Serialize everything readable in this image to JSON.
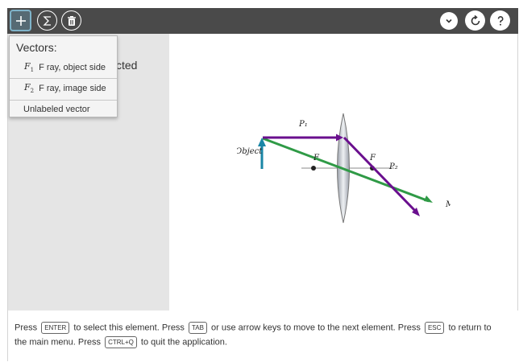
{
  "toolbar": {
    "buttons": [
      {
        "name": "add-button",
        "icon": "plus-icon"
      },
      {
        "name": "sum-button",
        "icon": "sigma-icon"
      },
      {
        "name": "delete-button",
        "icon": "trash-icon"
      },
      {
        "name": "dropdown-button",
        "icon": "chevron-down-icon"
      },
      {
        "name": "refresh-button",
        "icon": "refresh-icon"
      },
      {
        "name": "help-button",
        "icon": "question-icon"
      }
    ],
    "background": "#4a4a4a"
  },
  "sidebar": {
    "behind_text": "cted"
  },
  "menu": {
    "title": "Vectors:",
    "items": [
      {
        "symbol": "F",
        "subscript": "1",
        "label": "F ray, object side"
      },
      {
        "symbol": "F",
        "subscript": "2",
        "label": "F ray, image side"
      },
      {
        "symbol": "",
        "subscript": "",
        "label": "Unlabeled vector"
      }
    ]
  },
  "figure": {
    "labels": {
      "object": "Object",
      "p1": "P₁",
      "p2": "P₂",
      "f_left": "F",
      "f_right": "F",
      "m": "M"
    },
    "colors": {
      "purple": "#6a0f8e",
      "green": "#2f9a46",
      "blue": "#1a86a6",
      "lens": "#c9ccd3"
    }
  },
  "status": {
    "line1": {
      "t1": "Press",
      "k1": "ENTER",
      "t2": "to select this element. Press",
      "k2": "TAB",
      "t3": "or use arrow keys to move to the next element. Press",
      "k3": "ESC",
      "t4": "to return to"
    },
    "line2": {
      "t1": "the main menu. Press",
      "k1": "CTRL+Q",
      "t2": "to quit the application."
    }
  }
}
